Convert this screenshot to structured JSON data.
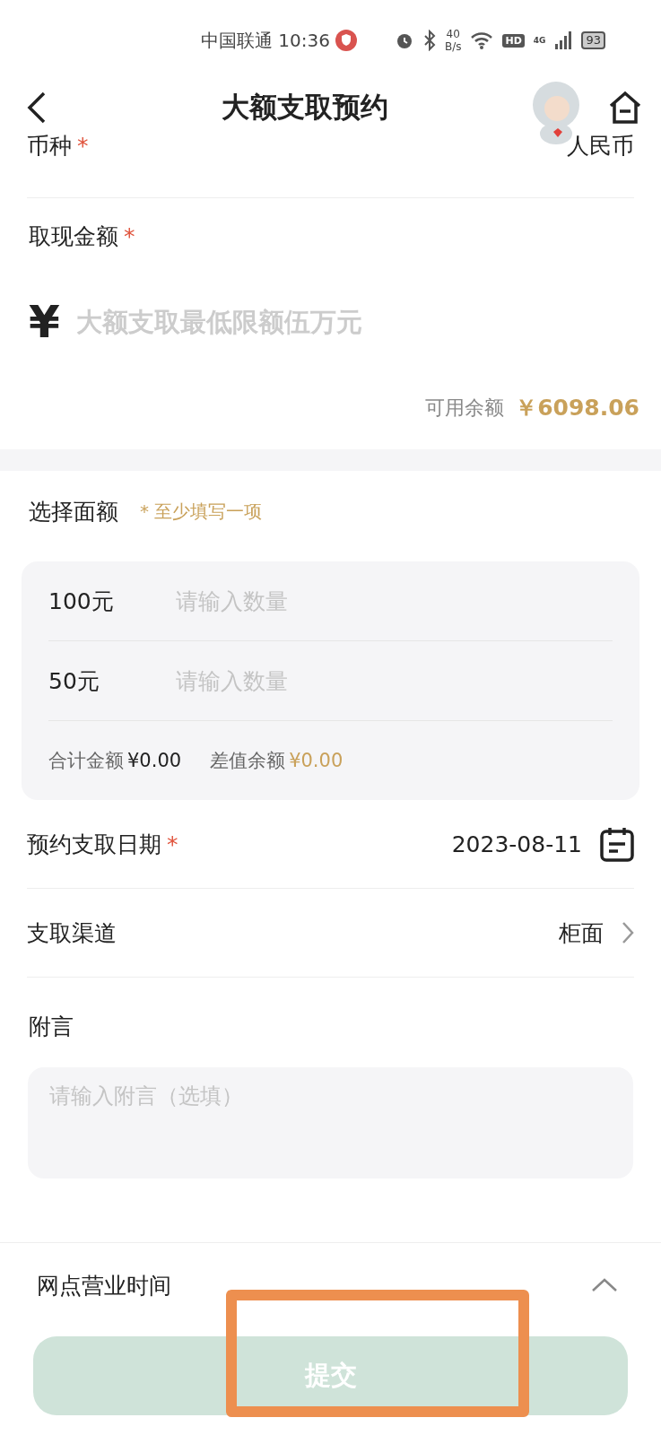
{
  "status_bar": {
    "carrier": "中国联通",
    "time": "10:36",
    "speed_value": "40",
    "speed_unit": "B/s",
    "network": "4G",
    "hd": "HD",
    "battery": "93"
  },
  "header": {
    "title": "大额支取预约"
  },
  "currency": {
    "label": "币种",
    "required_mark": "*",
    "value": "人民币"
  },
  "amount": {
    "label": "取现金额",
    "required_mark": "*",
    "symbol": "¥",
    "placeholder": "大额支取最低限额伍万元",
    "balance_label": "可用余额",
    "balance": "￥6098.06"
  },
  "denominations": {
    "label": "选择面额",
    "hint": "* 至少填写一项",
    "items": [
      {
        "name": "100元",
        "placeholder": "请输入数量"
      },
      {
        "name": "50元",
        "placeholder": "请输入数量"
      }
    ],
    "total_label": "合计金额",
    "total": "¥0.00",
    "diff_label": "差值余额",
    "diff": "¥0.00"
  },
  "date": {
    "label": "预约支取日期",
    "required_mark": "*",
    "value": "2023-08-11"
  },
  "channel": {
    "label": "支取渠道",
    "value": "柜面"
  },
  "note": {
    "label": "附言",
    "placeholder": "请输入附言（选填）"
  },
  "hours": {
    "label": "网点营业时间",
    "expanded": false
  },
  "submit": {
    "label": "提交",
    "disabled": true
  },
  "annotation": {
    "kind": "highlight"
  }
}
